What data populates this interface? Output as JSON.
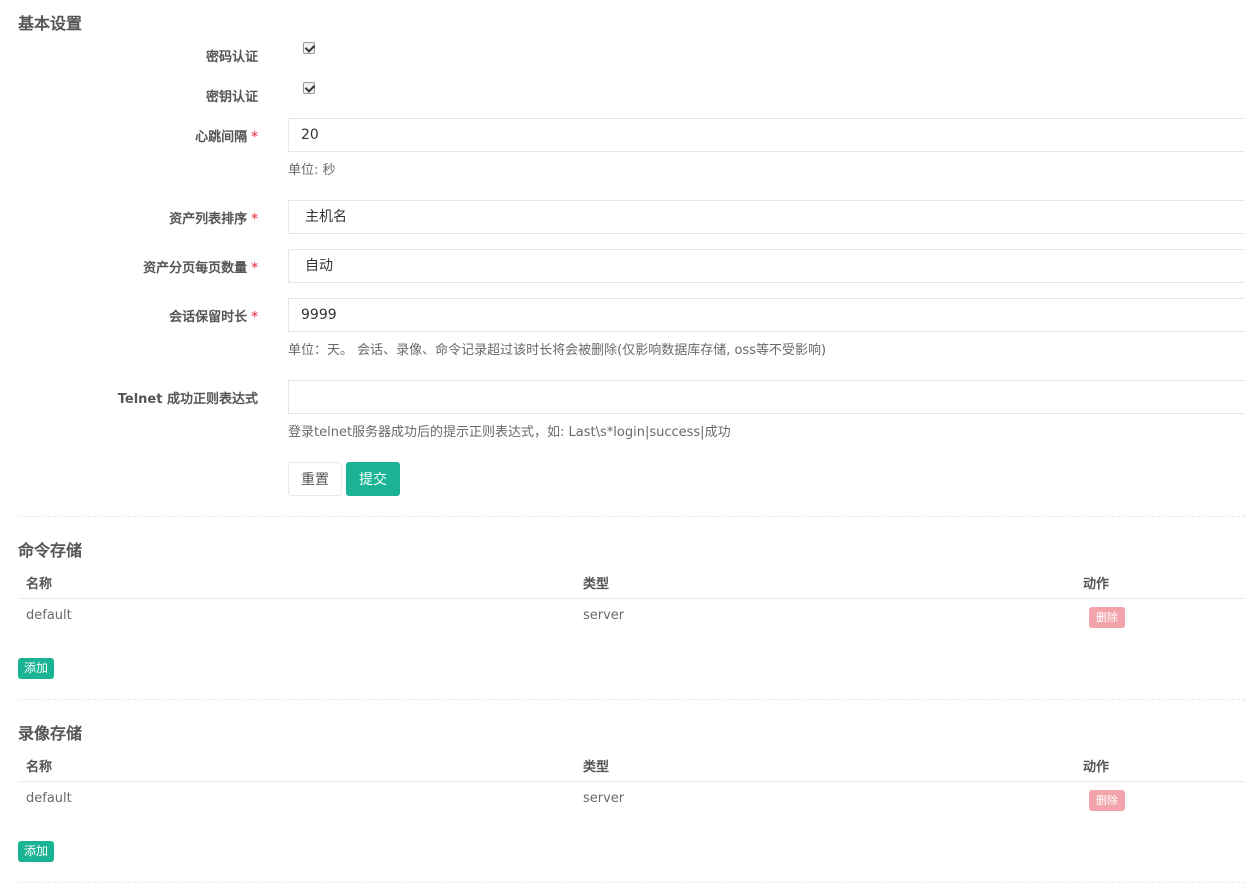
{
  "basic": {
    "title": "基本设置",
    "password_auth": {
      "label": "密码认证",
      "checked": true
    },
    "key_auth": {
      "label": "密钥认证",
      "checked": true
    },
    "heartbeat": {
      "label": "心跳间隔",
      "required": "*",
      "value": "20",
      "help": "单位: 秒"
    },
    "asset_sort": {
      "label": "资产列表排序",
      "required": "*",
      "value": "主机名"
    },
    "asset_page_size": {
      "label": "资产分页每页数量",
      "required": "*",
      "value": "自动"
    },
    "session_keep": {
      "label": "会话保留时长",
      "required": "*",
      "value": "9999",
      "help": "单位：天。 会话、录像、命令记录超过该时长将会被删除(仅影响数据库存储, oss等不受影响)"
    },
    "telnet_regex": {
      "label": "Telnet 成功正则表达式",
      "value": "",
      "help": "登录telnet服务器成功后的提示正则表达式，如: Last\\s*login|success|成功"
    },
    "reset_label": "重置",
    "submit_label": "提交"
  },
  "command_storage": {
    "title": "命令存储",
    "columns": [
      "名称",
      "类型",
      "动作"
    ],
    "rows": [
      {
        "name": "default",
        "type": "server",
        "action": "删除"
      }
    ],
    "add_label": "添加"
  },
  "replay_storage": {
    "title": "录像存储",
    "columns": [
      "名称",
      "类型",
      "动作"
    ],
    "rows": [
      {
        "name": "default",
        "type": "server",
        "action": "删除"
      }
    ],
    "add_label": "添加"
  },
  "colors": {
    "primary": "#1ab394",
    "danger_light": "#f2a4aa",
    "required": "#ed5565"
  }
}
